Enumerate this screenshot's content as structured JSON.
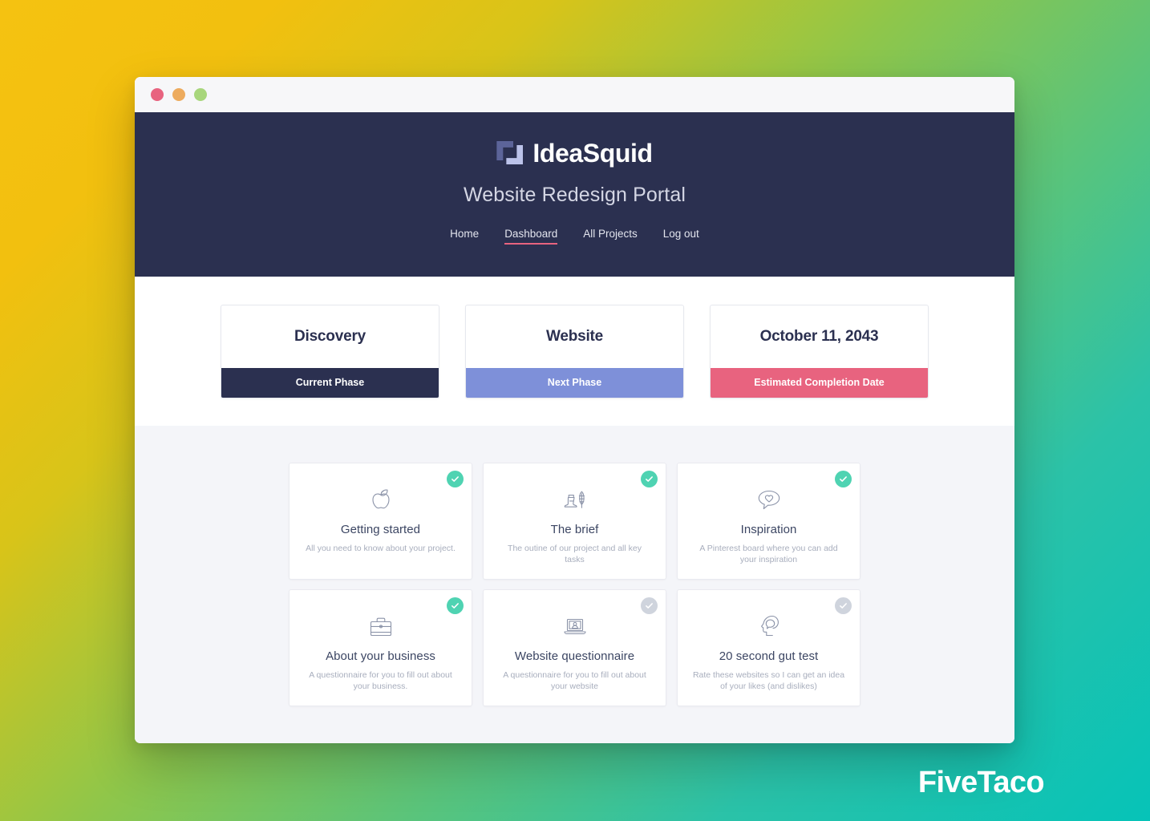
{
  "window_controls": [
    {
      "name": "close",
      "color": "#e8637f"
    },
    {
      "name": "minimize",
      "color": "#edab5e"
    },
    {
      "name": "maximize",
      "color": "#a8d67c"
    }
  ],
  "header": {
    "logo_text": "IdeaSquid",
    "logo_icon": "ideasquid-bracket-logo",
    "portal_title": "Website Redesign Portal",
    "background_color": "#2b3050",
    "nav": [
      {
        "label": "Home",
        "active": false
      },
      {
        "label": "Dashboard",
        "active": true
      },
      {
        "label": "All Projects",
        "active": false
      },
      {
        "label": "Log out",
        "active": false
      }
    ],
    "active_underline_color": "#e8637f"
  },
  "phase_cards": [
    {
      "value": "Discovery",
      "band_label": "Current Phase",
      "band_color": "#2b3050"
    },
    {
      "value": "Website",
      "band_label": "Next Phase",
      "band_color": "#7e90d9"
    },
    {
      "value": "October 11, 2043",
      "band_label": "Estimated Completion Date",
      "band_color": "#e8637f"
    }
  ],
  "tasks": [
    {
      "title": "Getting started",
      "description": "All you need to know about your project.",
      "icon": "apple-icon",
      "status": "done"
    },
    {
      "title": "The brief",
      "description": "The outine of our project and all key tasks",
      "icon": "inkwell-quill-icon",
      "status": "done"
    },
    {
      "title": "Inspiration",
      "description": "A Pinterest board where you can add your inspiration",
      "icon": "heart-speech-bubble-icon",
      "status": "done"
    },
    {
      "title": "About your business",
      "description": "A questionnaire for you to fill out about your business.",
      "icon": "briefcase-icon",
      "status": "done"
    },
    {
      "title": "Website questionnaire",
      "description": "A questionnaire for you to fill out about your website",
      "icon": "laptop-person-icon",
      "status": "todo"
    },
    {
      "title": "20 second gut test",
      "description": "Rate these websites so I can get an idea of your likes (and dislikes)",
      "icon": "head-thought-icon",
      "status": "todo"
    }
  ],
  "watermark": {
    "text": "FiveTaco"
  },
  "theme": {
    "done_badge_color": "#4fd3b2",
    "todo_badge_color": "#cfd4dd",
    "content_background": "#f4f5f9",
    "card_background": "#ffffff",
    "title_color": "#3c4663",
    "desc_color": "#a8aebd"
  }
}
